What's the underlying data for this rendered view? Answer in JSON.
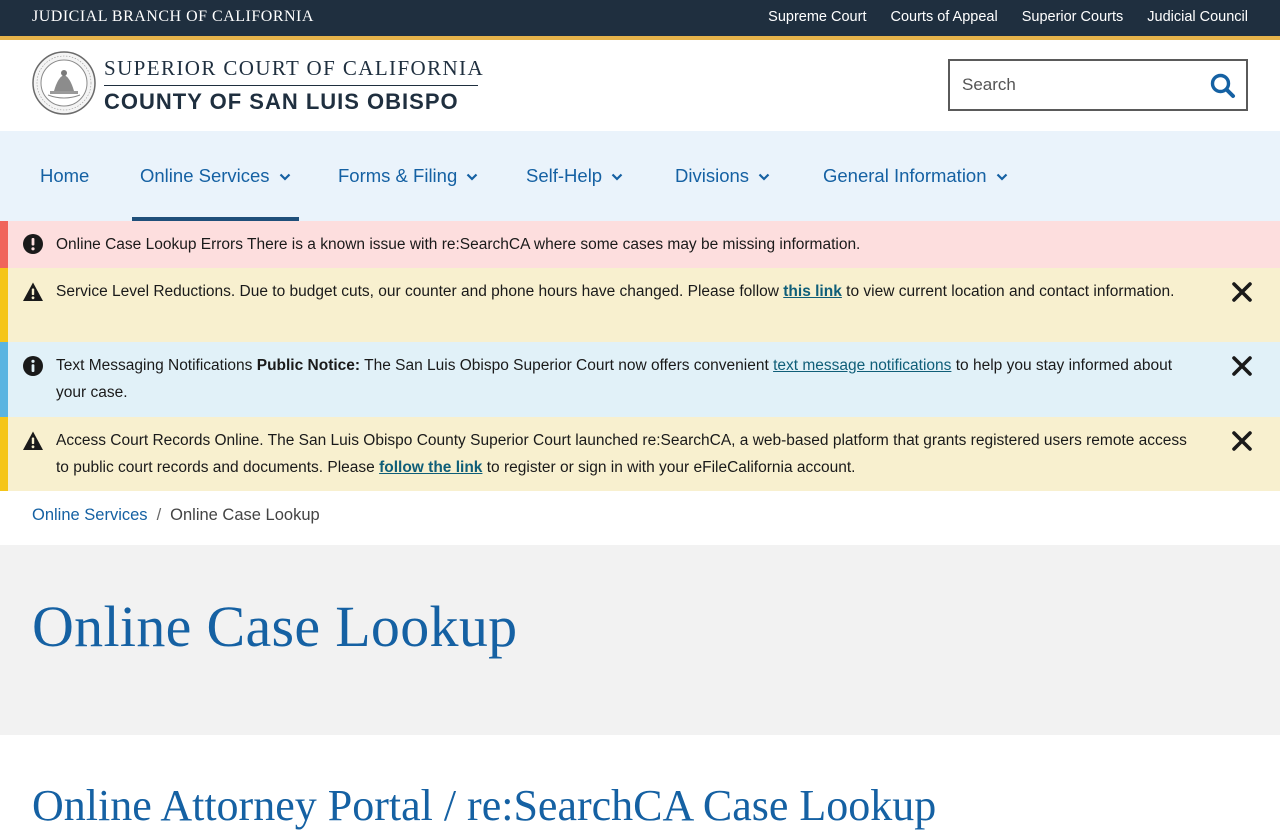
{
  "topbar": {
    "title": "JUDICIAL BRANCH OF CALIFORNIA",
    "links": [
      "Supreme Court",
      "Courts of Appeal",
      "Superior Courts",
      "Judicial Council"
    ]
  },
  "header": {
    "brand_line1": "SUPERIOR COURT OF CALIFORNIA",
    "brand_line2": "COUNTY OF SAN LUIS OBISPO",
    "search_placeholder": "Search"
  },
  "nav": {
    "items": [
      {
        "label": "Home"
      },
      {
        "label": "Online Services"
      },
      {
        "label": "Forms & Filing"
      },
      {
        "label": "Self-Help"
      },
      {
        "label": "Divisions"
      },
      {
        "label": "General Information"
      }
    ]
  },
  "alerts": [
    {
      "title": "Online Case Lookup Errors",
      "body": " There is a known issue with re:SearchCA where some cases may be missing information."
    },
    {
      "title": "Service Level Reductions.",
      "body_before": " Due to budget cuts, our counter and phone hours have changed. Please follow ",
      "link": "this link",
      "body_after": " to view current location and contact information."
    },
    {
      "title": "Text Messaging Notifications",
      "bold": " Public Notice:",
      "body_before": " The San Luis Obispo Superior Court now offers convenient ",
      "link": "text message notifications",
      "body_after": " to help you stay informed about your case."
    },
    {
      "title": "Access Court Records Online.",
      "body_before": " The San Luis Obispo County Superior Court launched re:SearchCA, a web-based platform that grants registered users remote access to public court records and documents. Please ",
      "link": "follow the link",
      "body_after": " to register or sign in with your eFileCalifornia account."
    }
  ],
  "breadcrumb": {
    "parent": "Online Services",
    "separator": "/",
    "current": "Online Case Lookup"
  },
  "page": {
    "title": "Online Case Lookup",
    "section_heading": "Online Attorney Portal / re:SearchCA Case Lookup"
  },
  "colors": {
    "topbar": "#1f2f3f",
    "accent_gold": "#e6b34a",
    "link_blue": "#1561a3",
    "nav_bg": "#eaf3fb"
  }
}
